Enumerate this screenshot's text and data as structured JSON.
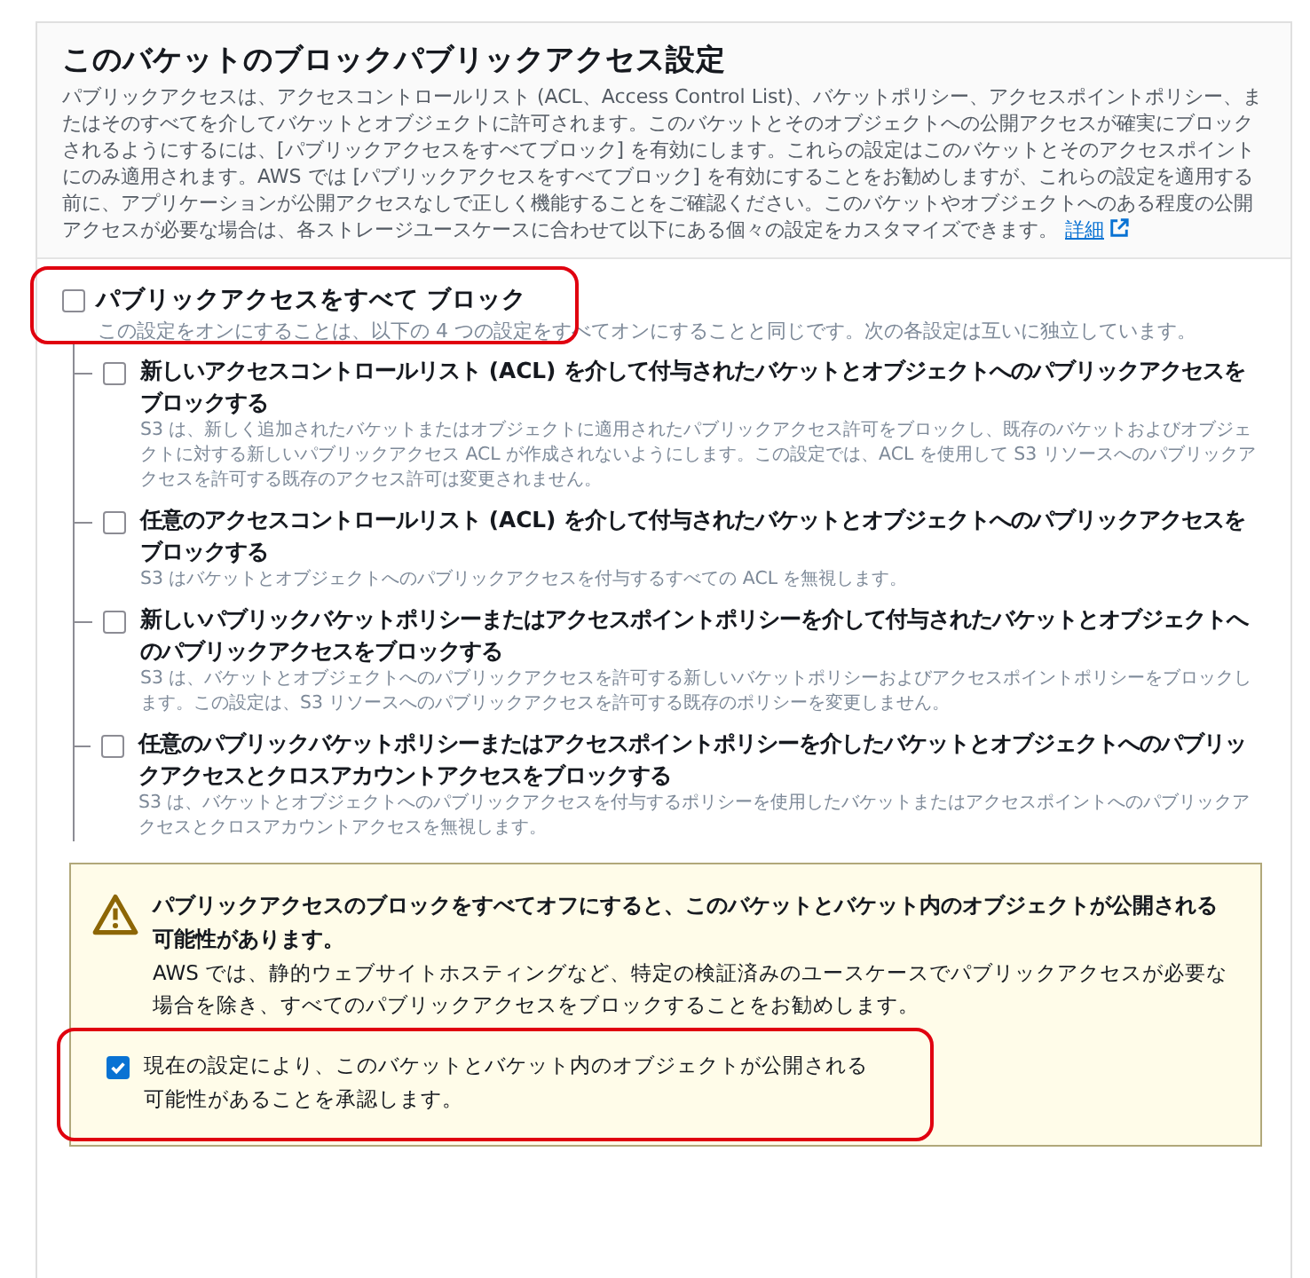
{
  "header": {
    "title": "このバケットのブロックパブリックアクセス設定",
    "description": "パブリックアクセスは、アクセスコントロールリスト (ACL、Access Control List)、バケットポリシー、アクセスポイントポリシー、またはそのすべてを介してバケットとオブジェクトに許可されます。このバケットとそのオブジェクトへの公開アクセスが確実にブロックされるようにするには、[パブリックアクセスをすべてブロック] を有効にします。これらの設定はこのバケットとそのアクセスポイントにのみ適用されます。AWS では [パブリックアクセスをすべてブロック] を有効にすることをお勧めしますが、これらの設定を適用する前に、アプリケーションが公開アクセスなしで正しく機能することをご確認ください。このバケットやオブジェクトへのある程度の公開アクセスが必要な場合は、各ストレージユースケースに合わせて以下にある個々の設定をカスタマイズできます。",
    "link": "詳細"
  },
  "block_all": {
    "label": "パブリックアクセスをすべて ブロック",
    "description": "この設定をオンにすることは、以下の 4 つの設定をすべてオンにすることと同じです。次の各設定は互いに独立しています。",
    "checked": false,
    "highlighted": true,
    "children": [
      {
        "label": "新しいアクセスコントロールリスト (ACL) を介して付与されたバケットとオブジェクトへのパブリックアクセスをブロックする",
        "description": "S3 は、新しく追加されたバケットまたはオブジェクトに適用されたパブリックアクセス許可をブロックし、既存のバケットおよびオブジェクトに対する新しいパブリックアクセス ACL が作成されないようにします。この設定では、ACL を使用して S3 リソースへのパブリックアクセスを許可する既存のアクセス許可は変更されません。",
        "checked": false
      },
      {
        "label": "任意のアクセスコントロールリスト (ACL) を介して付与されたバケットとオブジェクトへのパブリックアクセスをブロックする",
        "description": "S3 はバケットとオブジェクトへのパブリックアクセスを付与するすべての ACL を無視します。",
        "checked": false
      },
      {
        "label": "新しいパブリックバケットポリシーまたはアクセスポイントポリシーを介して付与されたバケットとオブジェクトへのパブリックアクセスをブロックする",
        "description": "S3 は、バケットとオブジェクトへのパブリックアクセスを許可する新しいバケットポリシーおよびアクセスポイントポリシーをブロックします。この設定は、S3 リソースへのパブリックアクセスを許可する既存のポリシーを変更しません。",
        "checked": false
      },
      {
        "label": "任意のパブリックバケットポリシーまたはアクセスポイントポリシーを介したバケットとオブジェクトへのパブリックアクセスとクロスアカウントアクセスをブロックする",
        "description": "S3 は、バケットとオブジェクトへのパブリックアクセスを付与するポリシーを使用したバケットまたはアクセスポイントへのパブリックアクセスとクロスアカウントアクセスを無視します。",
        "checked": false
      }
    ]
  },
  "warning": {
    "title": "パブリックアクセスのブロックをすべてオフにすると、このバケットとバケット内のオブジェクトが公開される可能性があります。",
    "text": "AWS では、静的ウェブサイトホスティングなど、特定の検証済みのユースケースでパブリックアクセスが必要な場合を除き、すべてのパブリックアクセスをブロックすることをお勧めします。",
    "acknowledge": {
      "label": "現在の設定により、このバケットとバケット内のオブジェクトが公開される可能性があることを承認します。",
      "checked": true,
      "highlighted": true
    }
  }
}
